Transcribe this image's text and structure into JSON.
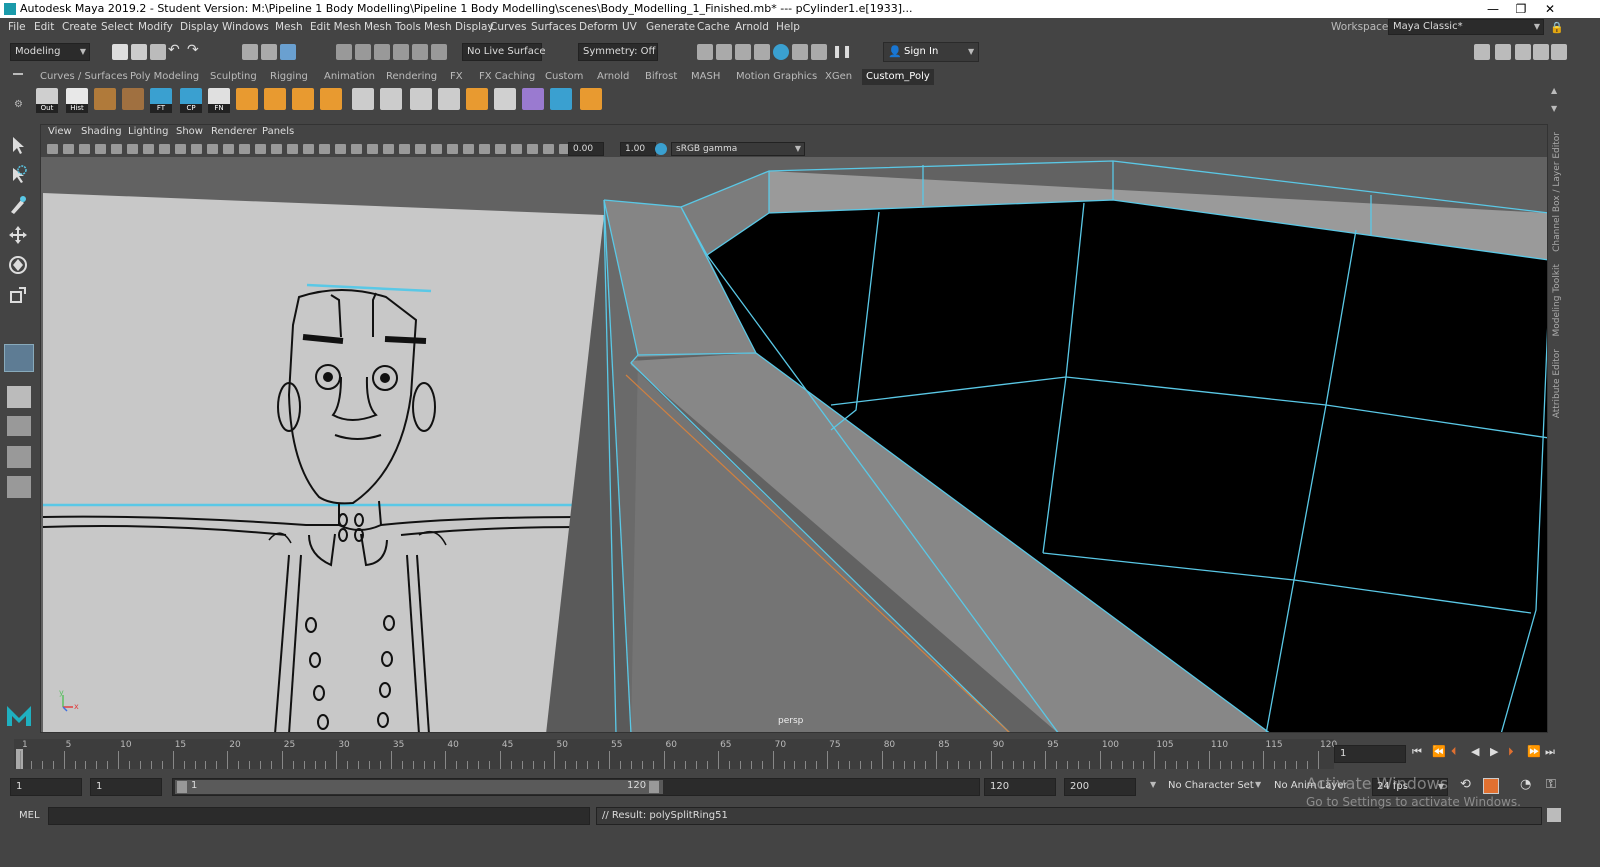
{
  "window": {
    "title": "Autodesk Maya 2019.2 - Student Version: M:\\Pipeline 1 Body Modelling\\Pipeline 1 Body Modelling\\scenes\\Body_Modelling_1_Finished.mb*   ---   pCylinder1.e[1933]...",
    "min": "—",
    "max": "❐",
    "close": "✕"
  },
  "menus": [
    "File",
    "Edit",
    "Create",
    "Select",
    "Modify",
    "Display",
    "Windows",
    "Mesh",
    "Edit Mesh",
    "Mesh Tools",
    "Mesh Display",
    "Curves",
    "Surfaces",
    "Deform",
    "UV",
    "Generate",
    "Cache",
    "Arnold",
    "Help"
  ],
  "workspace": {
    "label": "Workspace :",
    "value": "Maya Classic*"
  },
  "toolbar": {
    "mode": "Modeling",
    "live_surface": "No Live Surface",
    "symmetry": "Symmetry: Off",
    "signin": "Sign In"
  },
  "shelf_tabs": [
    "Curves / Surfaces",
    "Poly Modeling",
    "Sculpting",
    "Rigging",
    "Animation",
    "Rendering",
    "FX",
    "FX Caching",
    "Custom",
    "Arnold",
    "Bifrost",
    "MASH",
    "Motion Graphics",
    "XGen",
    "Custom_Poly"
  ],
  "shelf_active": "Custom_Poly",
  "shelf_icons": [
    {
      "label": "Out",
      "color": "#cfcfcf"
    },
    {
      "label": "Hist",
      "color": "#e8e8e8"
    },
    {
      "label": "",
      "color": "#b07a3a"
    },
    {
      "label": "",
      "color": "#a07040"
    },
    {
      "label": "FT",
      "color": "#3aa0d0"
    },
    {
      "label": "CP",
      "color": "#3aa0d0"
    },
    {
      "label": "FN",
      "color": "#e0e0e0"
    },
    {
      "label": "",
      "color": "#e89a30"
    },
    {
      "label": "",
      "color": "#e89a30"
    },
    {
      "label": "",
      "color": "#e89a30"
    },
    {
      "label": "",
      "color": "#e89a30"
    },
    {
      "label": "",
      "color": "#cccccc"
    },
    {
      "label": "",
      "color": "#cccccc"
    },
    {
      "label": "",
      "color": "#cccccc"
    },
    {
      "label": "",
      "color": "#cccccc"
    },
    {
      "label": "",
      "color": "#e89a30"
    },
    {
      "label": "",
      "color": "#d0d0d0"
    },
    {
      "label": "",
      "color": "#9a7ad0"
    },
    {
      "label": "",
      "color": "#3aa0d0"
    },
    {
      "label": "",
      "color": "#e89a30"
    }
  ],
  "panel_menus": [
    "View",
    "Shading",
    "Lighting",
    "Show",
    "Renderer",
    "Panels"
  ],
  "panel_toolbar": {
    "exposure": "0.00",
    "gamma": "1.00",
    "colorspace": "sRGB gamma"
  },
  "viewport": {
    "camera": "persp",
    "axis_y": "y",
    "axis_x": "x"
  },
  "right_tabs": [
    "Channel Box / Layer Editor",
    "Modeling Toolkit",
    "Attribute Editor"
  ],
  "timeline": {
    "ticks": [
      "1",
      "5",
      "10",
      "15",
      "20",
      "25",
      "30",
      "35",
      "40",
      "45",
      "50",
      "55",
      "60",
      "65",
      "70",
      "75",
      "80",
      "85",
      "90",
      "95",
      "100",
      "105",
      "110",
      "115",
      "120"
    ],
    "current_frame": "1"
  },
  "range": {
    "start": "1",
    "anim_start": "1",
    "slider_start": "1",
    "slider_end": "120",
    "end": "120",
    "anim_end": "200",
    "char_set": "No Character Set",
    "anim_layer": "No Anim Layer",
    "fps": "24 fps"
  },
  "cmd": {
    "lang": "MEL",
    "result": "// Result: polySplitRing51"
  },
  "watermark": {
    "line1": "Activate Windows",
    "line2": "Go to Settings to activate Windows."
  },
  "colors": {
    "accent": "#5ac8e6",
    "orange_edge": "#d08040"
  }
}
